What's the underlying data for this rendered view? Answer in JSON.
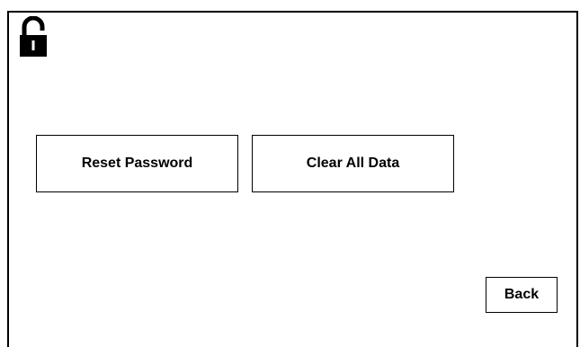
{
  "header": {
    "icon": "unlocked-padlock-icon"
  },
  "actions": {
    "reset_password_label": "Reset Password",
    "clear_all_data_label": "Clear All Data",
    "back_label": "Back"
  },
  "colors": {
    "background": "#ffffff",
    "foreground": "#000000"
  }
}
